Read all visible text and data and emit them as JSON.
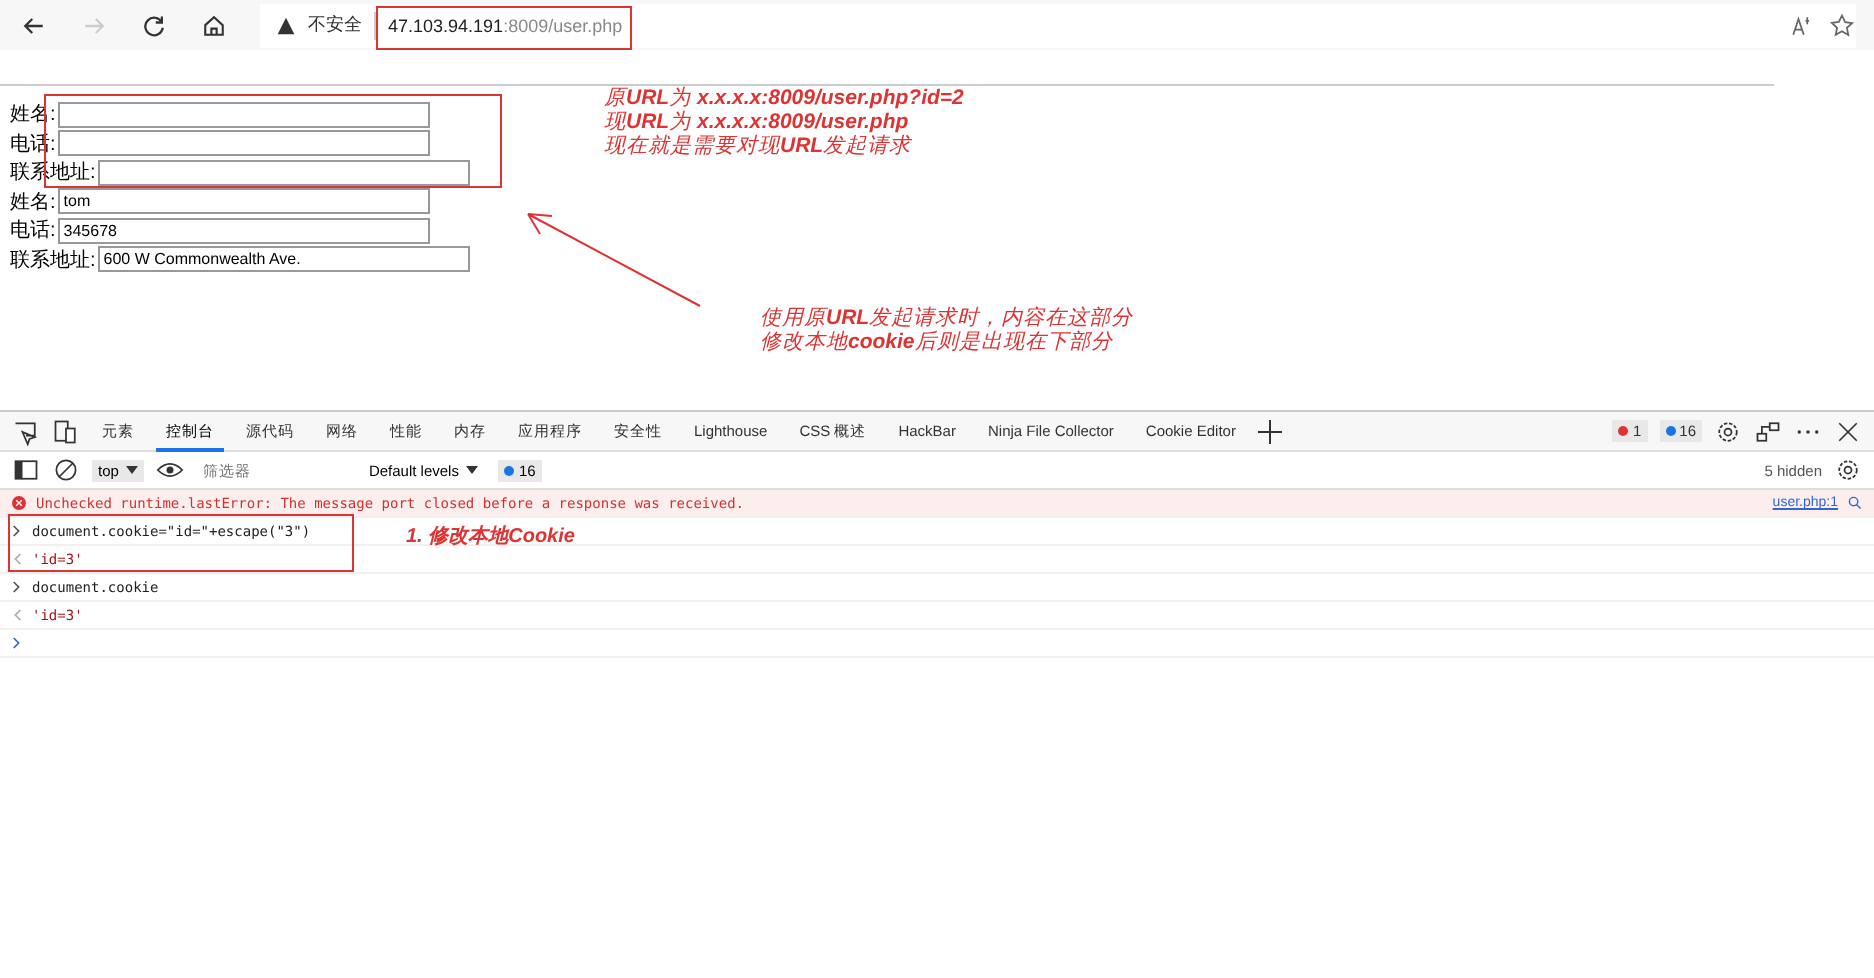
{
  "browser": {
    "security_label": "不安全",
    "url_host": "47.103.94.191",
    "url_rest": ":8009/user.php"
  },
  "page": {
    "forms": [
      {
        "fields": [
          {
            "label": "姓名:"
          },
          {
            "label": "电话:"
          },
          {
            "label": "联系地址:"
          }
        ]
      },
      {
        "fields": [
          {
            "label": "姓名:",
            "value": "tom"
          },
          {
            "label": "电话:",
            "value": "345678"
          },
          {
            "label": "联系地址:",
            "value": "600 W Commonwealth Ave."
          }
        ]
      }
    ],
    "annotations": [
      {
        "lines": [
          "原**URL**为 **x.x.x.x:8009/user.php?id=2**",
          "现**URL**为 **x.x.x.x:8009/user.php**",
          "现在就是需要对现**URL**发起请求"
        ]
      },
      {
        "lines": [
          "使用原**URL**发起请求时，内容在这部分",
          "修改本地**cookie**后则是出现在下部分"
        ]
      }
    ]
  },
  "devtools": {
    "tabs": [
      {
        "label": "元素",
        "selected": false
      },
      {
        "label": "控制台",
        "selected": true
      },
      {
        "label": "源代码",
        "selected": false
      },
      {
        "label": "网络",
        "selected": false
      },
      {
        "label": "性能",
        "selected": false
      },
      {
        "label": "内存",
        "selected": false
      },
      {
        "label": "应用程序",
        "selected": false
      },
      {
        "label": "安全性",
        "selected": false
      },
      {
        "label": "Lighthouse",
        "selected": false
      },
      {
        "label": "CSS 概述",
        "selected": false
      },
      {
        "label": "HackBar",
        "selected": false
      },
      {
        "label": "Ninja File Collector",
        "selected": false
      },
      {
        "label": "Cookie Editor",
        "selected": false
      }
    ],
    "error_count": "1",
    "info_count": "16",
    "context": "top",
    "filter_placeholder": "筛选器",
    "levels": "Default levels",
    "issues_count": "16",
    "hidden": "5 hidden",
    "console": [
      {
        "kind": "error",
        "text": "Unchecked runtime.lastError: The message port closed before a response was received.",
        "source": "user.php:1"
      },
      {
        "kind": "input",
        "text": "document.cookie=\"id=\"+escape(\"3\")"
      },
      {
        "kind": "output",
        "text": "'id=3'"
      },
      {
        "kind": "input",
        "text": "document.cookie"
      },
      {
        "kind": "output",
        "text": "'id=3'"
      }
    ],
    "note": "1. 修改本地Cookie"
  }
}
